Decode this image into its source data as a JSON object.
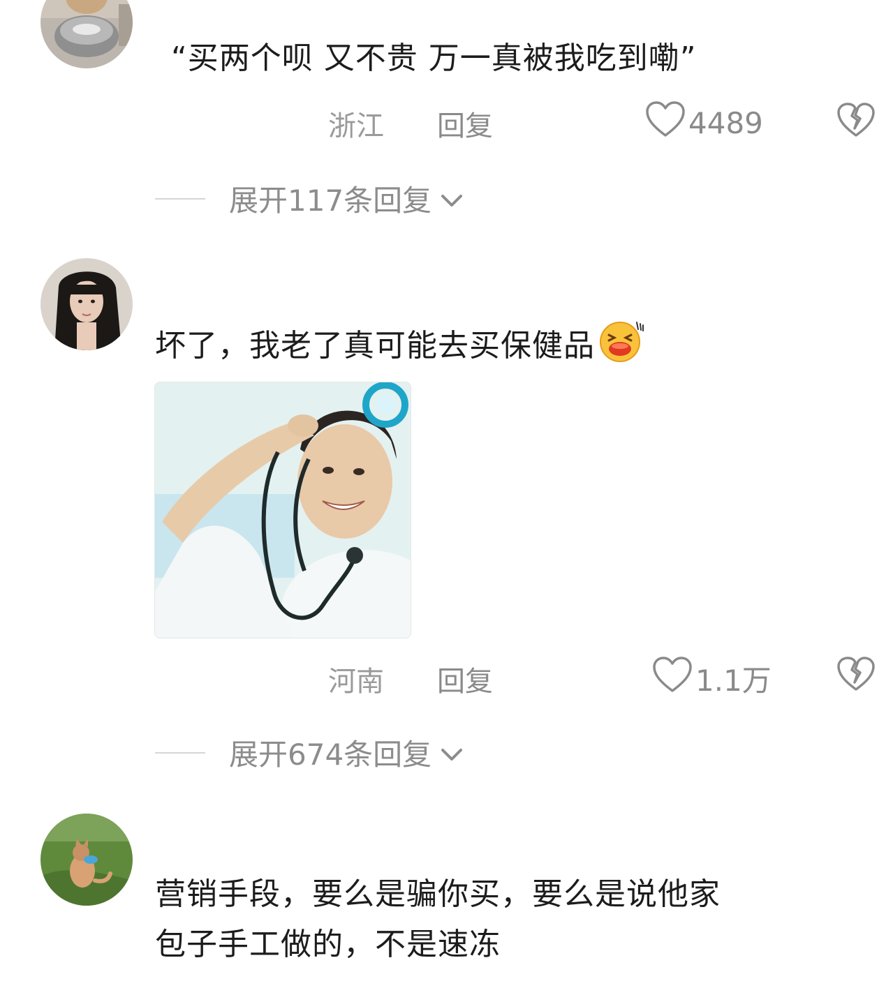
{
  "comments": [
    {
      "avatar": "dog-avatar",
      "text": "“买两个呗 又不贵 万一真被我吃到嘞”",
      "location": "浙江",
      "reply_label": "回复",
      "likes": "4489",
      "expand_label": "展开117条回复"
    },
    {
      "avatar": "girl-avatar",
      "text": "坏了，我老了真可能去买保健品",
      "emoji": "laughing-face-emoji",
      "sticker": "nurse-stethoscope-sticker",
      "location": "河南",
      "reply_label": "回复",
      "likes": "1.1万",
      "expand_label": "展开674条回复"
    },
    {
      "avatar": "cat-on-grass-avatar",
      "text_line1": "营销手段，要么是骗你买，要么是说他家",
      "text_line2": "包子手工做的，不是速冻"
    }
  ],
  "icons": {
    "like": "heart-outline-icon",
    "dislike": "broken-heart-icon",
    "expand": "chevron-down-icon"
  },
  "colors": {
    "text": "#1c1c1c",
    "meta": "#9a9a9a",
    "divider": "#d6d6d6"
  }
}
